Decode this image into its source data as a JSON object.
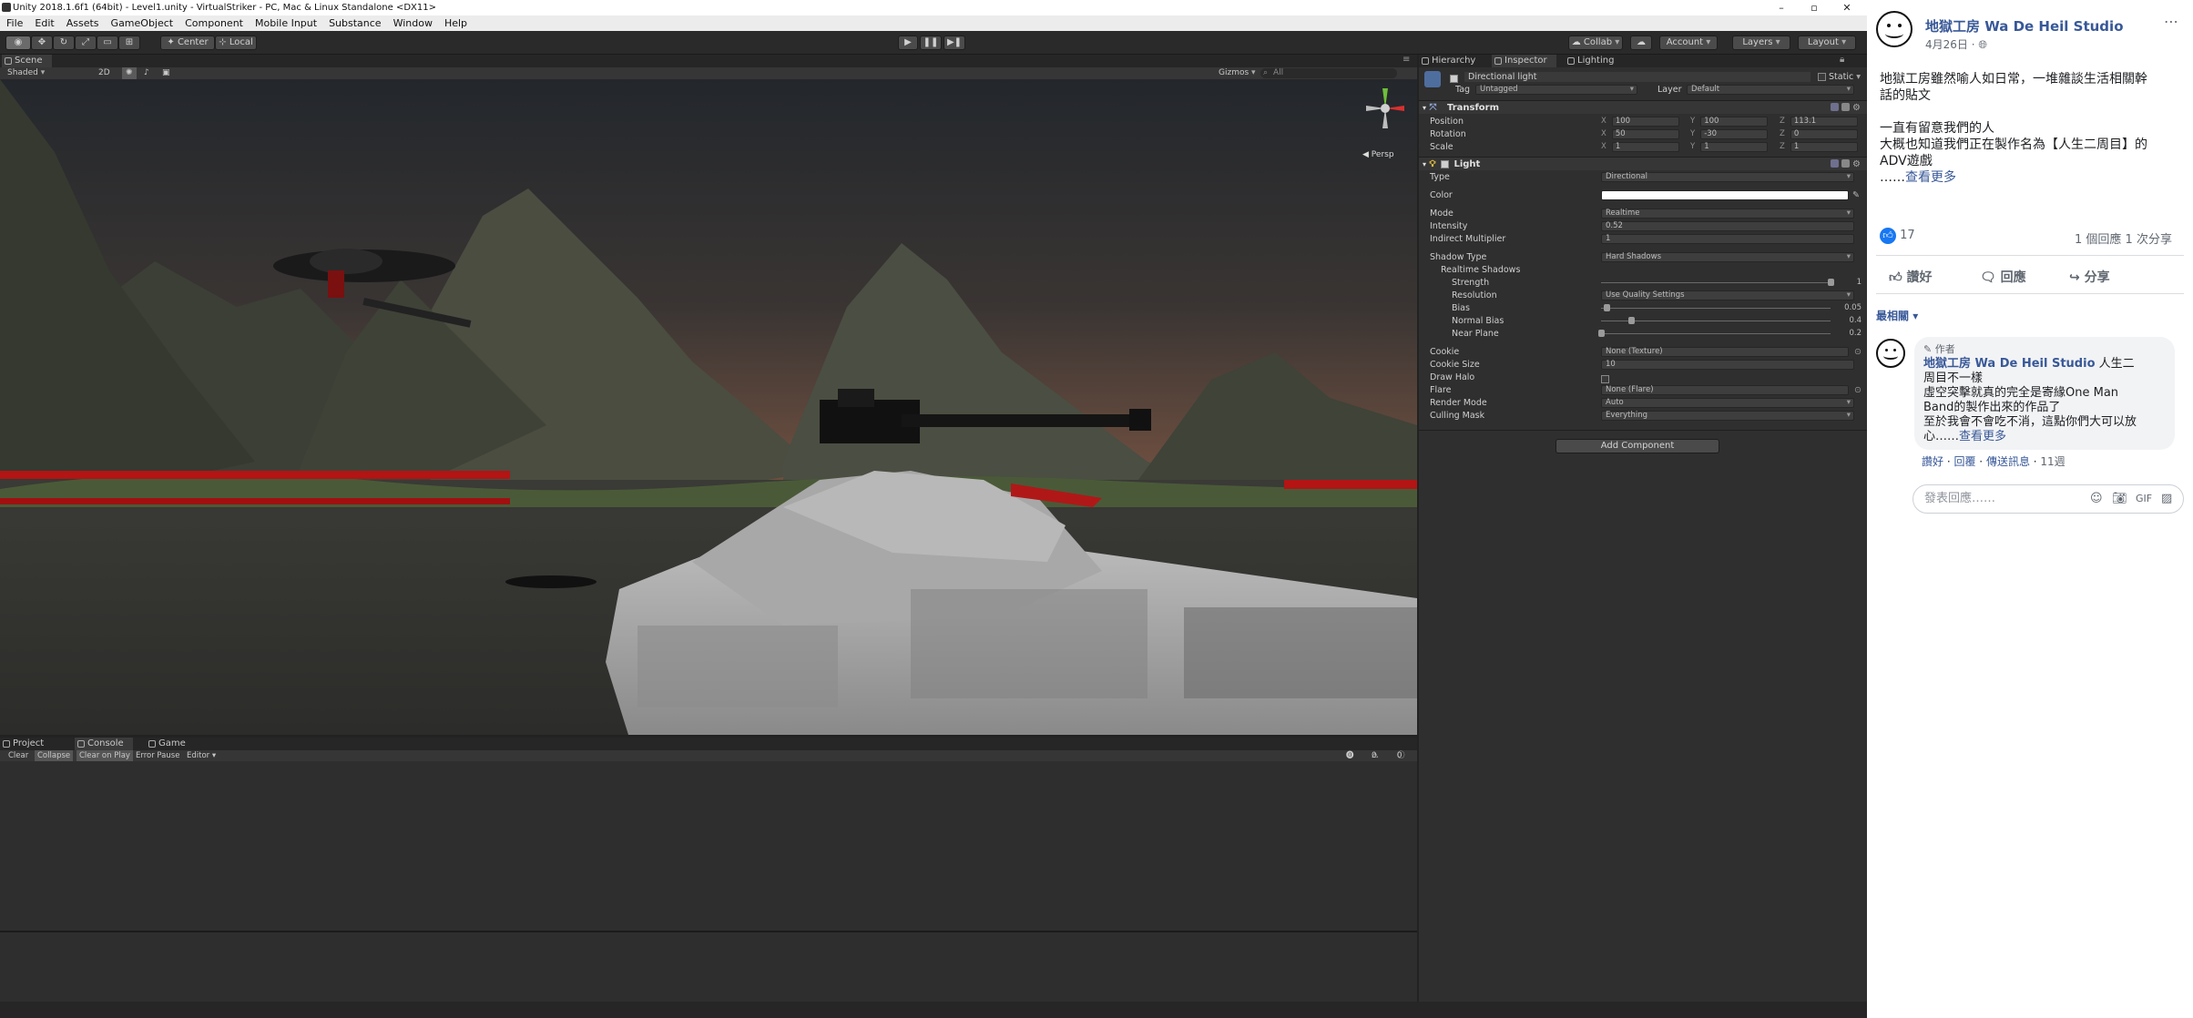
{
  "unity": {
    "window_title": "Unity 2018.1.6f1 (64bit) - Level1.unity - VirtualStriker - PC, Mac & Linux Standalone <DX11>",
    "window_controls": [
      "–",
      "▫",
      "✕"
    ],
    "menu": [
      "File",
      "Edit",
      "Assets",
      "GameObject",
      "Component",
      "Mobile Input",
      "Substance",
      "Window",
      "Help"
    ],
    "toolbar": {
      "pivot": "Center",
      "space": "Local",
      "play_icon": "▶",
      "pause_icon": "❚❚",
      "step_icon": "▶❚",
      "collab": "Collab",
      "account": "Account",
      "layers": "Layers",
      "layout": "Layout"
    },
    "scene": {
      "tab_label": "Scene",
      "shading": "Shaded",
      "mode_2d": "2D",
      "gizmos": "Gizmos",
      "search": "All",
      "persp_label": "Persp"
    },
    "inspector_tabs": {
      "hierarchy": "Hierarchy",
      "inspector": "Inspector",
      "lighting": "Lighting"
    },
    "inspector": {
      "object_name": "Directional light",
      "static_label": "Static",
      "tag_label": "Tag",
      "tag_value": "Untagged",
      "layer_label": "Layer",
      "layer_value": "Default",
      "transform": {
        "title": "Transform",
        "position_label": "Position",
        "rotation_label": "Rotation",
        "scale_label": "Scale",
        "position": {
          "x": "100",
          "y": "100",
          "z": "113.1"
        },
        "rotation": {
          "x": "50",
          "y": "-30",
          "z": "0"
        },
        "scale": {
          "x": "1",
          "y": "1",
          "z": "1"
        }
      },
      "light": {
        "title": "Light",
        "type_label": "Type",
        "type_value": "Directional",
        "color_label": "Color",
        "color_value": "#ffffff",
        "mode_label": "Mode",
        "mode_value": "Realtime",
        "intensity_label": "Intensity",
        "intensity_value": "0.52",
        "indirect_label": "Indirect Multiplier",
        "indirect_value": "1",
        "shadow_type_label": "Shadow Type",
        "shadow_type_value": "Hard Shadows",
        "realtime_shadows_label": "Realtime Shadows",
        "strength_label": "Strength",
        "strength_value": "1",
        "strength_level": 1.0,
        "resolution_label": "Resolution",
        "resolution_value": "Use Quality Settings",
        "bias_label": "Bias",
        "bias_value": "0.05",
        "bias_level": 0.025,
        "normal_bias_label": "Normal Bias",
        "normal_bias_value": "0.4",
        "normal_bias_level": 0.13,
        "near_plane_label": "Near Plane",
        "near_plane_value": "0.2",
        "near_plane_level": 0.0,
        "cookie_label": "Cookie",
        "cookie_value": "None (Texture)",
        "cookie_size_label": "Cookie Size",
        "cookie_size_value": "10",
        "draw_halo_label": "Draw Halo",
        "flare_label": "Flare",
        "flare_value": "None (Flare)",
        "render_mode_label": "Render Mode",
        "render_mode_value": "Auto",
        "culling_mask_label": "Culling Mask",
        "culling_mask_value": "Everything"
      },
      "add_component": "Add Component"
    },
    "bottom_tabs": {
      "project": "Project",
      "console": "Console",
      "game": "Game"
    },
    "console_tools": [
      "Clear",
      "Collapse",
      "Clear on Play",
      "Error Pause",
      "Editor ▾"
    ],
    "console_counts": {
      "errors": "0",
      "warnings": "0",
      "logs": "0"
    }
  },
  "fb": {
    "page_name": "地獄工房 Wa De Heil Studio",
    "date": "4月26日",
    "privacy_icon": "globe-icon",
    "post_lines": [
      "地獄工房雖然喻人如日常，一堆雜談生活相關幹",
      "話的貼文",
      "",
      "一直有留意我們的人",
      "大概也知道我們正在製作名為【人生二周目】的",
      "ADV遊戲"
    ],
    "see_more_prefix": "……",
    "see_more": "查看更多",
    "reactions_count": "17",
    "comments_count": "1 個回應",
    "shares_count": "1 次分享",
    "actions": {
      "like": "讚好",
      "comment": "回應",
      "share": "分享"
    },
    "sort_label": "最相關",
    "comment": {
      "author_badge": "作者",
      "author": "地獄工房 Wa De Heil Studio",
      "text_lines": [
        "人生二",
        "周目不一樣",
        "虛空突擊就真的完全是寄緣One Man",
        "Band的製作出來的作品了",
        "至於我會不會吃不消，這點你們大可以放",
        "心……"
      ],
      "see_more": "查看更多",
      "like": "讚好",
      "reply": "回覆",
      "send_message": "傳送訊息",
      "time": "11週"
    },
    "comment_placeholder": "發表回應……",
    "accent": "#385898"
  }
}
